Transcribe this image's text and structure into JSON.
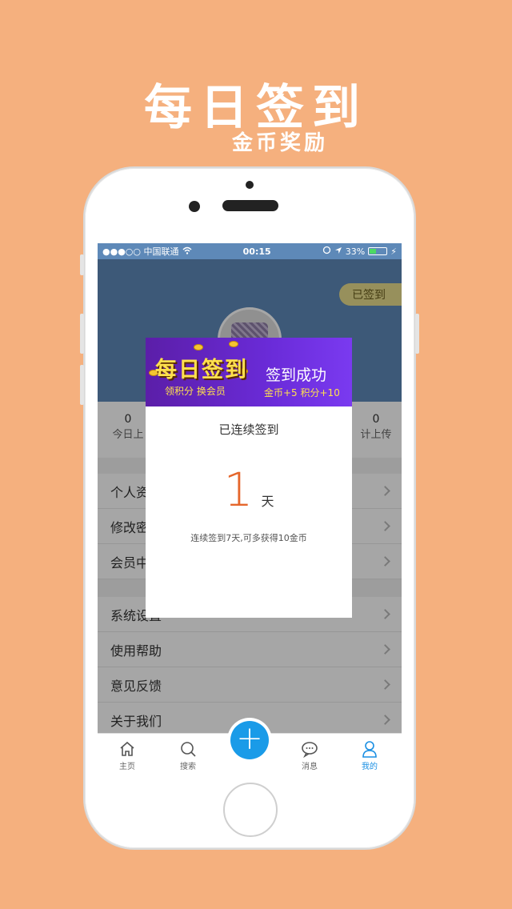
{
  "promo": {
    "title": "每日签到",
    "subtitle": "金币奖励"
  },
  "status_bar": {
    "carrier": "●●●○○ 中国联通",
    "wifi": "wifi-icon",
    "time": "00:15",
    "location": "location-icon",
    "battery_percent": "33%",
    "battery_level": 0.33
  },
  "profile": {
    "checked_in_label": "已签到"
  },
  "stats": [
    {
      "value": "0",
      "label": "今日上"
    },
    {
      "value": "0",
      "label": "计上传"
    }
  ],
  "menu_group1": [
    {
      "label": "个人资"
    },
    {
      "label": "修改密"
    },
    {
      "label": "会员中"
    }
  ],
  "menu_group2": [
    {
      "label": "系统设置"
    },
    {
      "label": "使用帮助"
    },
    {
      "label": "意见反馈"
    },
    {
      "label": "关于我们"
    }
  ],
  "tabbar": {
    "tabs": [
      {
        "label": "主页",
        "icon": "home-icon"
      },
      {
        "label": "搜索",
        "icon": "search-icon"
      },
      {
        "label": "消息",
        "icon": "message-icon"
      },
      {
        "label": "我的",
        "icon": "user-icon"
      }
    ],
    "plus_label": "+",
    "active_color": "#1a8fe3"
  },
  "dialog": {
    "banner_title": "每日签到",
    "banner_slogan": "领积分 换会员",
    "banner_success": "签到成功",
    "banner_reward": "金币+5 积分+10",
    "heading": "已连续签到",
    "days": "1",
    "days_unit": "天",
    "tip": "连续签到7天,可多获得10金币"
  },
  "colors": {
    "background": "#F5B07E",
    "header": "#5E89B8",
    "accent": "#E5662B",
    "banner": "#6a2bd8"
  }
}
